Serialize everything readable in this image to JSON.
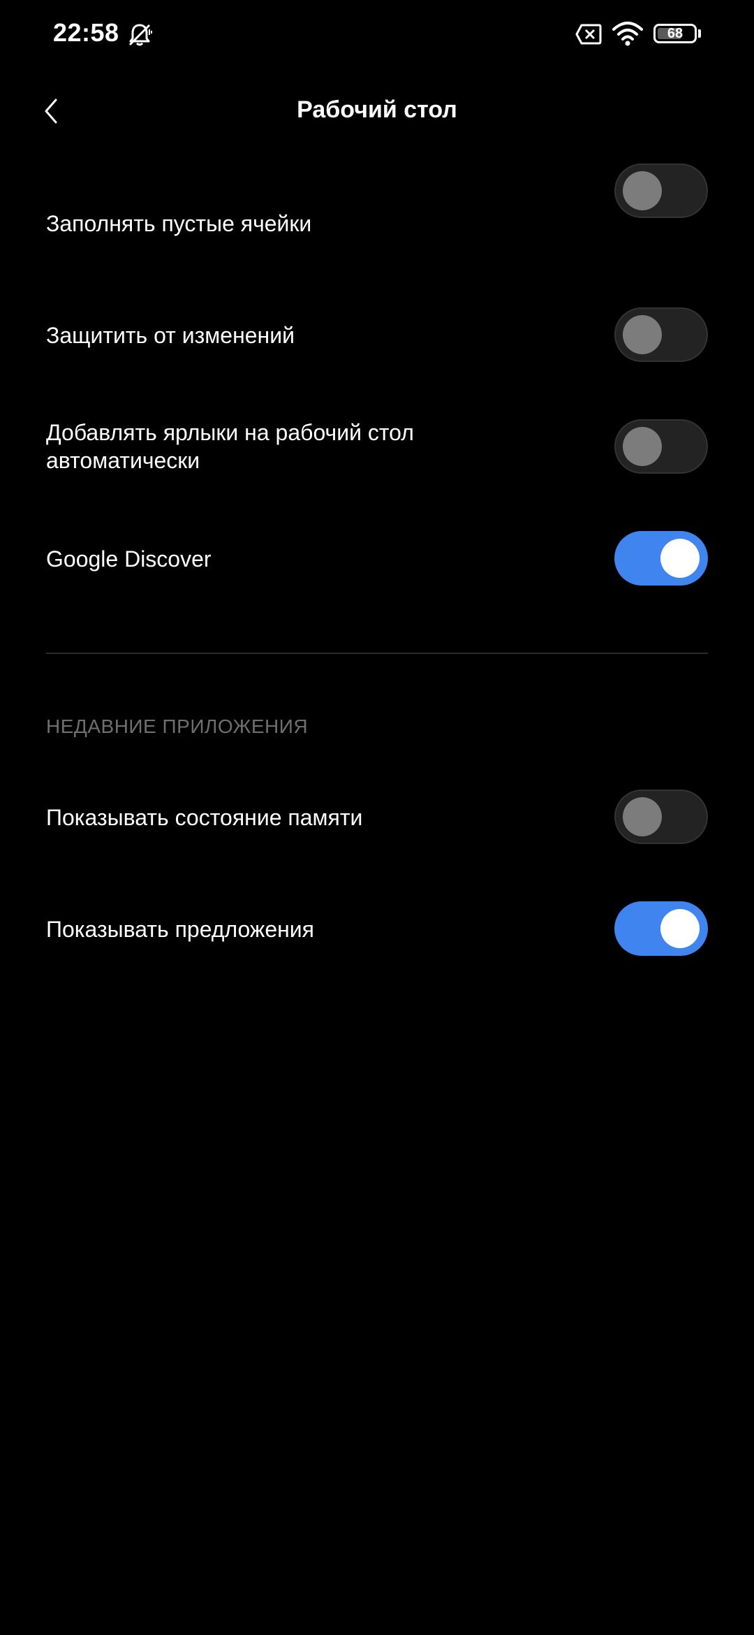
{
  "status_bar": {
    "time": "22:58",
    "icons": [
      "bell-off-icon",
      "sim-none-icon",
      "wifi-icon",
      "battery-icon"
    ],
    "battery_level": "68"
  },
  "header": {
    "back_icon": "chevron-left-icon",
    "title": "Рабочий стол"
  },
  "settings": [
    {
      "label": "Заполнять пустые ячейки",
      "enabled": false
    },
    {
      "label": "Защитить от изменений",
      "enabled": false
    },
    {
      "label": "Добавлять ярлыки на рабочий стол автоматически",
      "enabled": false
    },
    {
      "label": "Google Discover",
      "enabled": true
    }
  ],
  "recent_apps": {
    "section_title": "НЕДАВНИЕ ПРИЛОЖЕНИЯ",
    "settings": [
      {
        "label": "Показывать состояние памяти",
        "enabled": false
      },
      {
        "label": "Показывать предложения",
        "enabled": true
      }
    ]
  },
  "colors": {
    "background": "#000000",
    "accent": "#3f84ef",
    "toggle_off": "#232323",
    "section_header": "#6f6f6f"
  }
}
